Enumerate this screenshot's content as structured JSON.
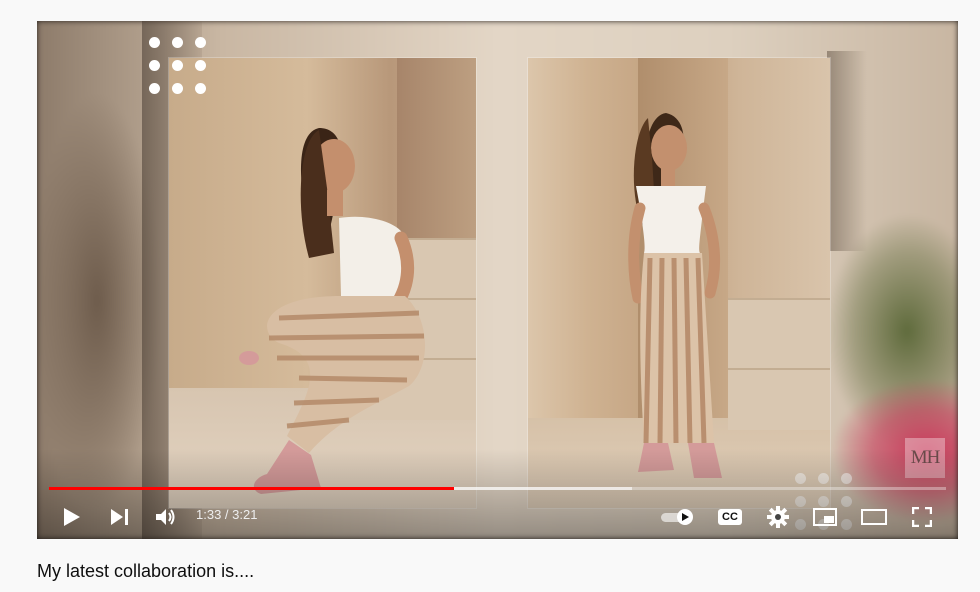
{
  "video": {
    "watermark": "MH",
    "progress": {
      "played_fraction": 0.452,
      "buffered_fraction": 0.65
    },
    "time": {
      "current": "1:33",
      "separator": " / ",
      "duration": "3:21"
    },
    "controls": {
      "play": "play-icon",
      "next": "next-icon",
      "volume": "volume-icon",
      "autoplay": "autoplay-toggle-icon",
      "captions": "CC",
      "settings": "gear-icon",
      "miniplayer": "miniplayer-icon",
      "theater": "theater-mode-icon",
      "fullscreen": "fullscreen-icon"
    },
    "accent_color": "#ff0000"
  },
  "caption": {
    "text": "My latest collaboration is...."
  }
}
